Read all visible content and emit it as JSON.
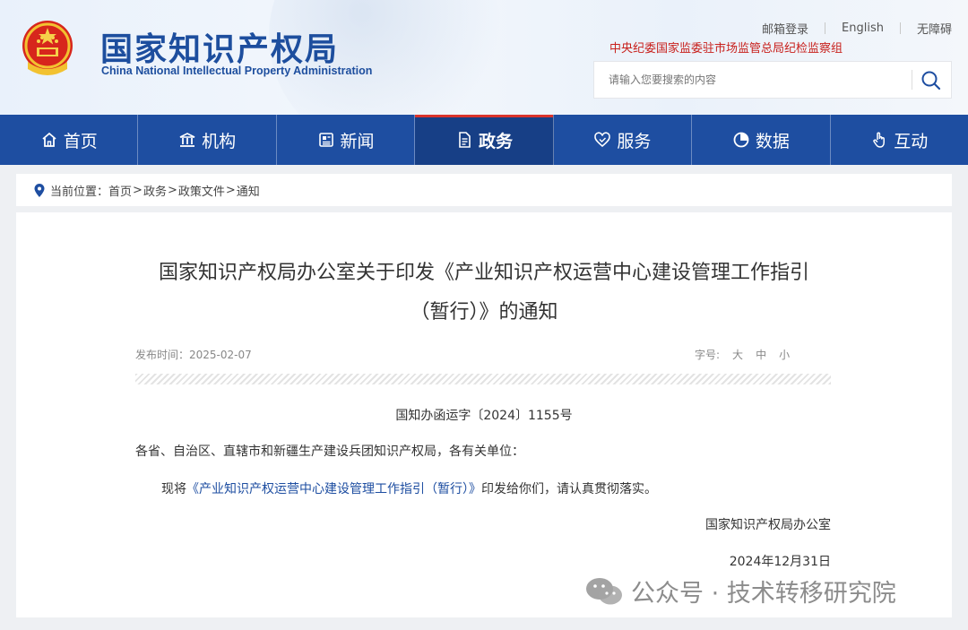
{
  "header": {
    "logo_cn": "国家知识产权局",
    "logo_en": "China National Intellectual Property Administration",
    "top_links": [
      "邮箱登录",
      "English",
      "无障碍"
    ],
    "discipline_text": "中央纪委国家监委驻市场监管总局纪检监察组",
    "search": {
      "placeholder": "请输入您要搜索的内容"
    }
  },
  "nav": {
    "items": [
      {
        "label": "首页",
        "icon": "home-icon"
      },
      {
        "label": "机构",
        "icon": "institution-icon"
      },
      {
        "label": "新闻",
        "icon": "news-icon"
      },
      {
        "label": "政务",
        "icon": "document-icon",
        "active": true
      },
      {
        "label": "服务",
        "icon": "service-icon"
      },
      {
        "label": "数据",
        "icon": "chart-icon"
      },
      {
        "label": "互动",
        "icon": "hand-icon"
      }
    ]
  },
  "breadcrumb": {
    "prefix": "当前位置：",
    "items": [
      "首页",
      "政务",
      "政策文件",
      "通知"
    ],
    "separator": ">"
  },
  "article": {
    "title_line1": "国家知识产权局办公室关于印发《产业知识产权运营中心建设管理工作指引",
    "title_line2": "（暂行）》的通知",
    "publish_label": "发布时间：",
    "publish_date": "2025-02-07",
    "fontsize_label": "字号:",
    "fontsize_options": [
      "大",
      "中",
      "小"
    ],
    "doc_number": "国知办函运字〔2024〕1155号",
    "addressee": "各省、自治区、直辖市和新疆生产建设兵团知识产权局，各有关单位：",
    "body_prefix": "现将",
    "body_link": "《产业知识产权运营中心建设管理工作指引（暂行）》",
    "body_suffix": "印发给你们，请认真贯彻落实。",
    "signature": "国家知识产权局办公室",
    "date": "2024年12月31日"
  },
  "watermark": {
    "text": "公众号 · 技术转移研究院"
  },
  "colors": {
    "brand_blue": "#1e4ea1",
    "active_nav": "#173f86",
    "red": "#c8201c"
  }
}
